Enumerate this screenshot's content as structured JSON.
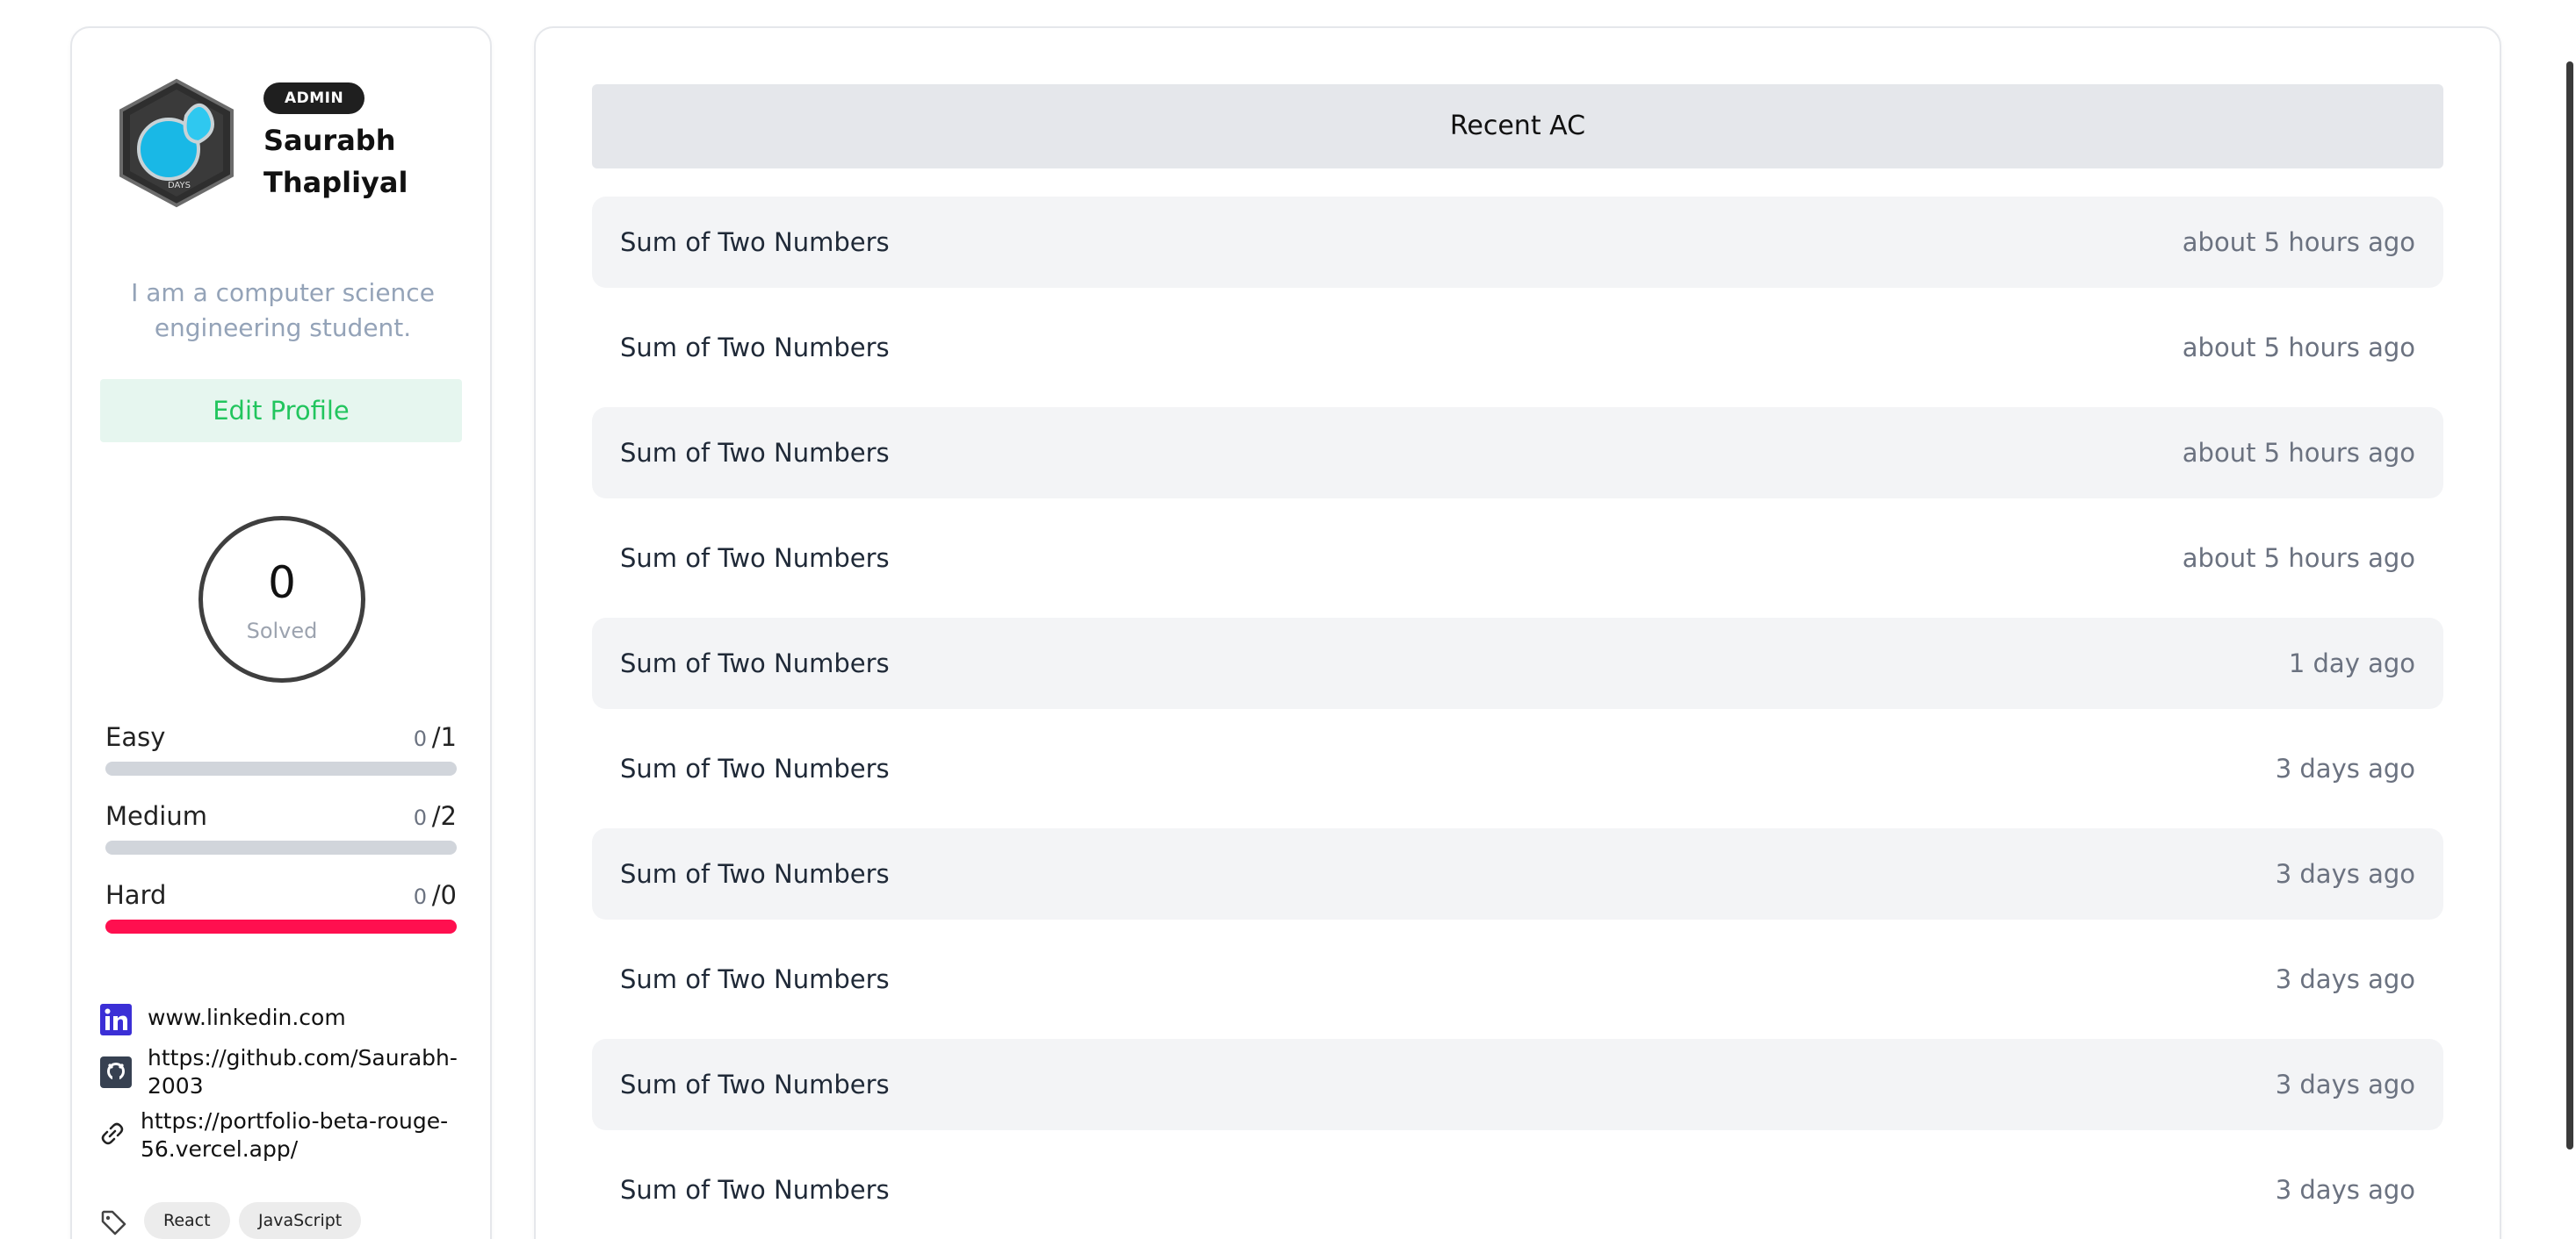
{
  "profile": {
    "role_badge": "ADMIN",
    "name": "Saurabh Thapliyal",
    "bio": "I am a computer science engineering student.",
    "edit_label": "Edit Profile",
    "avatar_text": "DAYS",
    "solved": {
      "count": "0",
      "label": "Solved"
    },
    "difficulty": [
      {
        "name": "Easy",
        "solved": "0",
        "total": "/1",
        "progress": 0
      },
      {
        "name": "Medium",
        "solved": "0",
        "total": "/2",
        "progress": 0
      },
      {
        "name": "Hard",
        "solved": "0",
        "total": "/0",
        "progress": 1
      }
    ],
    "links": [
      {
        "icon": "linkedin-icon",
        "text": "www.linkedin.com"
      },
      {
        "icon": "github-icon",
        "text": "https://github.com/Saurabh-2003"
      },
      {
        "icon": "link-icon",
        "text": "https://portfolio-beta-rouge-56.vercel.app/"
      }
    ],
    "tags": [
      "React",
      "JavaScript"
    ]
  },
  "recent_ac": {
    "title": "Recent AC",
    "items": [
      {
        "title": "Sum of Two Numbers",
        "time": "about 5 hours ago"
      },
      {
        "title": "Sum of Two Numbers",
        "time": "about 5 hours ago"
      },
      {
        "title": "Sum of Two Numbers",
        "time": "about 5 hours ago"
      },
      {
        "title": "Sum of Two Numbers",
        "time": "about 5 hours ago"
      },
      {
        "title": "Sum of Two Numbers",
        "time": "1 day ago"
      },
      {
        "title": "Sum of Two Numbers",
        "time": "3 days ago"
      },
      {
        "title": "Sum of Two Numbers",
        "time": "3 days ago"
      },
      {
        "title": "Sum of Two Numbers",
        "time": "3 days ago"
      },
      {
        "title": "Sum of Two Numbers",
        "time": "3 days ago"
      },
      {
        "title": "Sum of Two Numbers",
        "time": "3 days ago"
      }
    ]
  },
  "colors": {
    "accent_green": "#22c55e",
    "hard_bar": "#ff0f4f",
    "linkedin_blue": "#3b2fd6"
  }
}
